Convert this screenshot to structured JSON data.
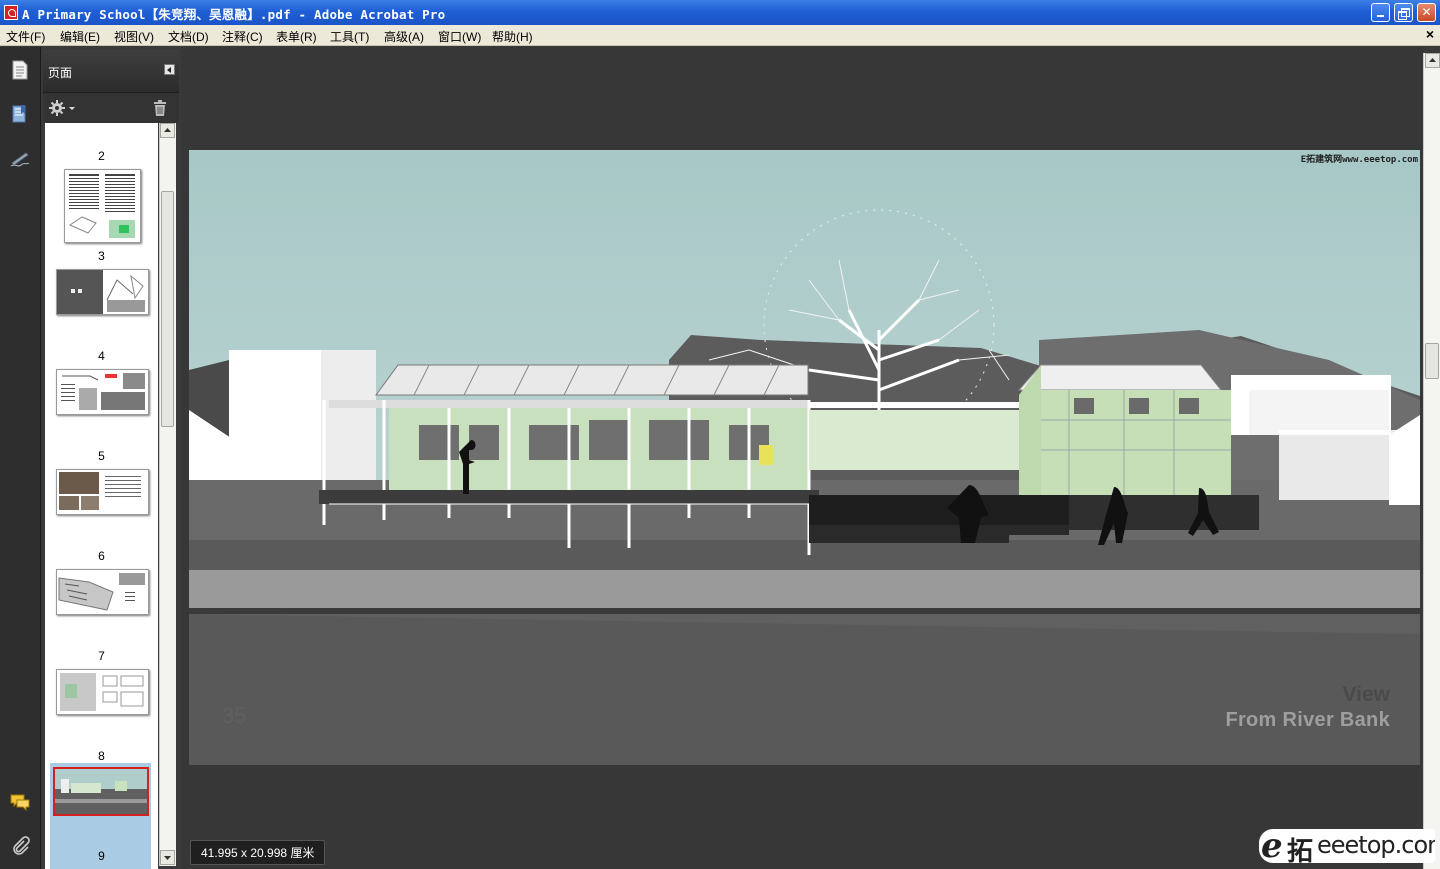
{
  "window": {
    "title": "A Primary School【朱竞翔、吴恩融】.pdf - Adobe Acrobat Pro"
  },
  "menu": {
    "file": "文件(F)",
    "edit": "编辑(E)",
    "view": "视图(V)",
    "document": "文档(D)",
    "comments": "注释(C)",
    "forms": "表单(R)",
    "tools": "工具(T)",
    "advanced": "高级(A)",
    "window": "窗口(W)",
    "help": "帮助(H)",
    "close_doc": "×"
  },
  "pages_panel": {
    "title": "页面",
    "thumbnails": [
      {
        "num": "2"
      },
      {
        "num": "3"
      },
      {
        "num": "4"
      },
      {
        "num": "5"
      },
      {
        "num": "6"
      },
      {
        "num": "7"
      },
      {
        "num": "8",
        "selected": true
      },
      {
        "num": "9"
      }
    ]
  },
  "document": {
    "watermark_top": "E拓建筑网www.eeetop.com",
    "caption_view": "View",
    "caption_from": "From  River Bank",
    "page_number": "35"
  },
  "status": {
    "page_size": "41.995 x 20.998 厘米"
  },
  "logo": {
    "e": "e",
    "tuo": "拓",
    "site": "eeetop.com"
  },
  "colors": {
    "titlebar": "#1f5fd6",
    "selection_border": "#d62020",
    "sky": "#aecdcb"
  }
}
